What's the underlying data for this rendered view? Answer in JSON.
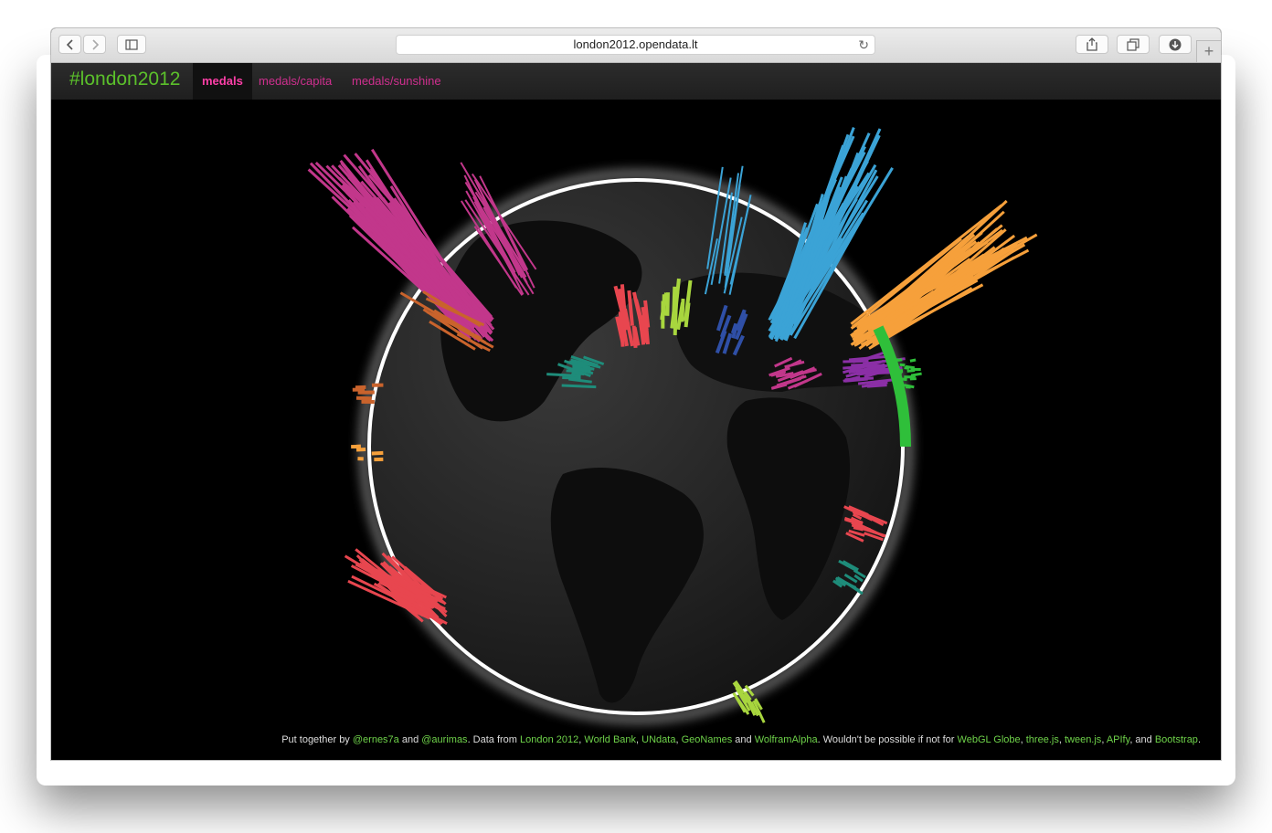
{
  "browser": {
    "url": "london2012.opendata.lt",
    "back_icon": "chevron-left-icon",
    "forward_icon": "chevron-right-icon"
  },
  "navbar": {
    "brand": "#london2012",
    "tabs": [
      {
        "label": "medals",
        "active": true
      },
      {
        "label": "medals/capita",
        "active": false
      },
      {
        "label": "medals/sunshine",
        "active": false
      }
    ]
  },
  "footer": {
    "t1": "Put together by ",
    "l1": "@ernes7a",
    "t2": " and ",
    "l2": "@aurimas",
    "t3": ". Data from ",
    "l3": "London 2012",
    "t4": ", ",
    "l4": "World Bank",
    "t5": ", ",
    "l5": "UNdata",
    "t6": ", ",
    "l6": "GeoNames",
    "t7": " and ",
    "l7": "WolframAlpha",
    "t8": ". Wouldn't be possible if not for ",
    "l8": "WebGL Globe",
    "t9": ", ",
    "l9": "three.js",
    "t10": ", ",
    "l10": "tween.js",
    "t11": ", ",
    "l11": "APIfy",
    "t12": ", and ",
    "l12": "Bootstrap",
    "t13": "."
  },
  "colors": {
    "brand": "#5bc02b",
    "tab": "#cf2f8f",
    "tab_active": "#ff3fa8",
    "link": "#6fd34a",
    "magenta": "#c2378b",
    "orange": "#f6a03b",
    "blue": "#3ba3d6",
    "red": "#e8464f",
    "lime": "#a8d63e",
    "teal": "#1e8c7a",
    "purple": "#8b2fa6",
    "green": "#2fbf3a",
    "navy": "#2f4fa6",
    "rust": "#c9632c"
  }
}
